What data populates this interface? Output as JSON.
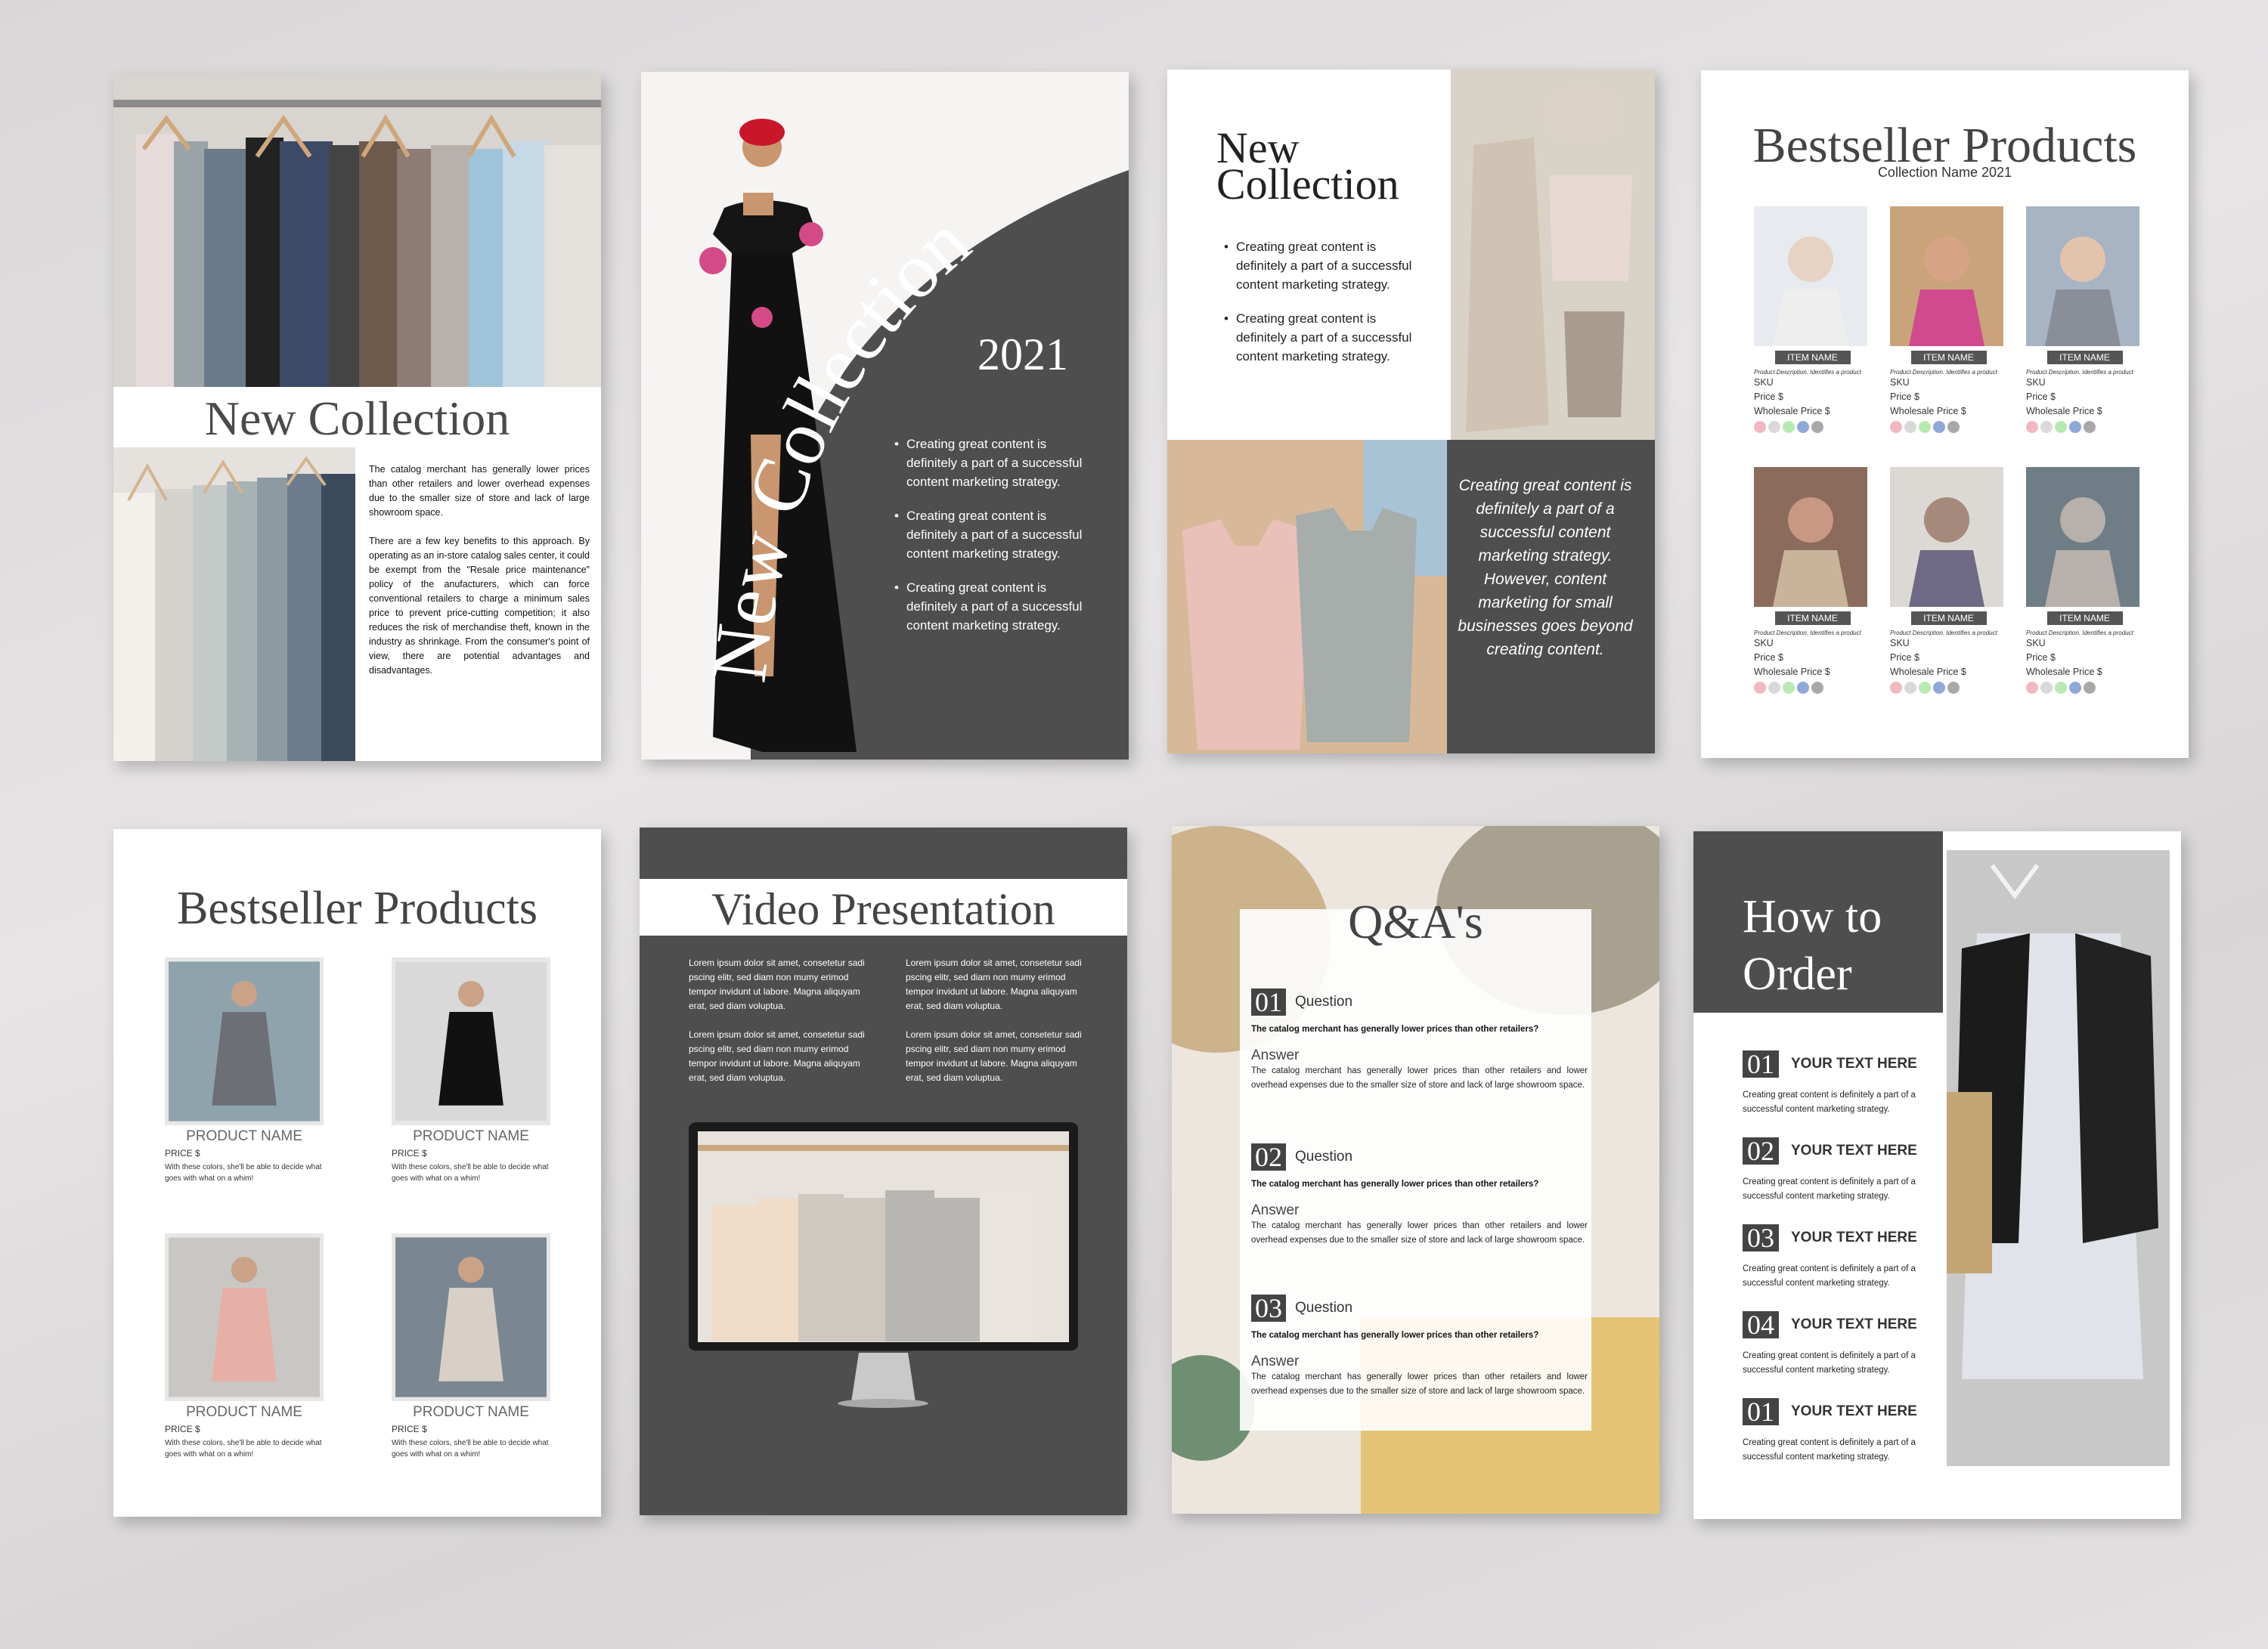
{
  "p1": {
    "title": "New Collection",
    "para1": "The catalog merchant has generally lower prices than other retailers and lower overhead expenses due to the smaller size of store and lack of large showroom space.",
    "para2": "There are a few key benefits to this approach. By operating as an in-store catalog sales center, it could be exempt from the \"Resale price maintenance\" policy of the anufacturers, which can force conventional retailers to charge a minimum sales price to prevent price-cutting competition; it also reduces the risk of merchandise theft, known in the industry as shrinkage. From the consumer's point of view, there are potential advantages and disadvantages."
  },
  "p2": {
    "title_word1": "New",
    "title_word2": "Collection",
    "year": "2021",
    "bullets": [
      "Creating great content is definitely a part of a successful content marketing strategy.",
      "Creating great content is definitely a part of a successful content marketing strategy.",
      "Creating great content is definitely a part of a successful content marketing strategy."
    ]
  },
  "p3": {
    "title_line1": "New",
    "title_line2": "Collection",
    "bullets": [
      "Creating great content is definitely a part of a successful content marketing strategy.",
      "Creating great content is definitely a part of a successful content marketing strategy."
    ],
    "quote": "Creating great content is definitely a part of a successful content marketing strategy. However, content marketing for small businesses goes beyond creating content."
  },
  "p4": {
    "title": "Bestseller Products",
    "subtitle": "Collection Name 2021",
    "item_name": "ITEM NAME",
    "desc": "Product Description. Identifies a product",
    "sku": "SKU",
    "price": "Price  $",
    "wholesale": "Wholesale Price  $",
    "swatches": [
      "#f2b8bf",
      "#d9d9d9",
      "#b7eab0",
      "#8fa8d8",
      "#a8a8a8"
    ]
  },
  "p5": {
    "title": "Bestseller Products",
    "product_name": "PRODUCT NAME",
    "price": "PRICE  $",
    "desc": "With these colors, she'll be able to decide what goes with what on a whim!"
  },
  "p6": {
    "title": "Video Presentation",
    "lorem1": "Lorem ipsum dolor sit amet, consetetur sadi pscing elitr, sed diam non mumy erimod tempor invidunt ut labore. Magna aliquyam erat, sed diam voluptua.",
    "lorem2": "Lorem ipsum dolor sit amet, consetetur sadi pscing elitr, sed diam non mumy erimod tempor invidunt ut labore. Magna aliquyam erat, sed diam voluptua."
  },
  "p7": {
    "title": "Q&A's",
    "question_label": "Question",
    "answer_label": "Answer",
    "question": "The catalog merchant has generally lower prices than other retailers?",
    "answer": "The catalog merchant has generally lower prices than other retailers and lower overhead expenses due to the smaller size of store and lack of large showroom space.",
    "nums": [
      "01",
      "02",
      "03"
    ]
  },
  "p8": {
    "title_line1": "How to",
    "title_line2": "Order",
    "heading": "YOUR TEXT HERE",
    "desc": "Creating great content is definitely a part of a successful content marketing strategy.",
    "nums": [
      "01",
      "02",
      "03",
      "04",
      "01"
    ]
  },
  "colors": {
    "dark": "#4e4e4e",
    "text": "#444444"
  }
}
